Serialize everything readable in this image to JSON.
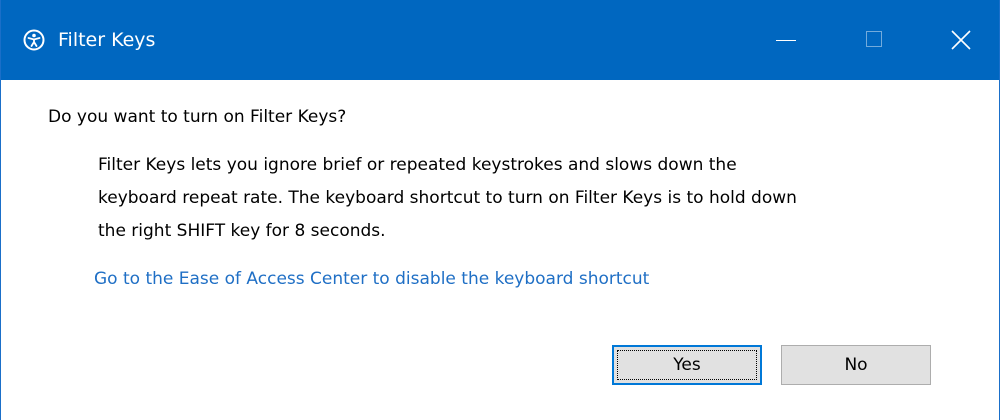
{
  "window": {
    "title": "Filter Keys",
    "accent_color": "#0067c0",
    "app_icon": "ease-of-access-icon",
    "controls": {
      "minimize_icon": "minimize-icon",
      "maximize_icon": "maximize-icon",
      "close_icon": "close-icon"
    }
  },
  "dialog": {
    "question": "Do you want to turn on Filter Keys?",
    "description_lines": [
      "Filter Keys lets you ignore brief or repeated keystrokes and slows down the",
      "keyboard repeat rate.  The keyboard shortcut to turn on Filter Keys is to hold down",
      "the right SHIFT key for 8 seconds."
    ],
    "link_text": "Go to the Ease of Access Center to disable the keyboard shortcut",
    "link_color": "#1f6fc5",
    "buttons": {
      "yes_label": "Yes",
      "no_label": "No"
    }
  }
}
